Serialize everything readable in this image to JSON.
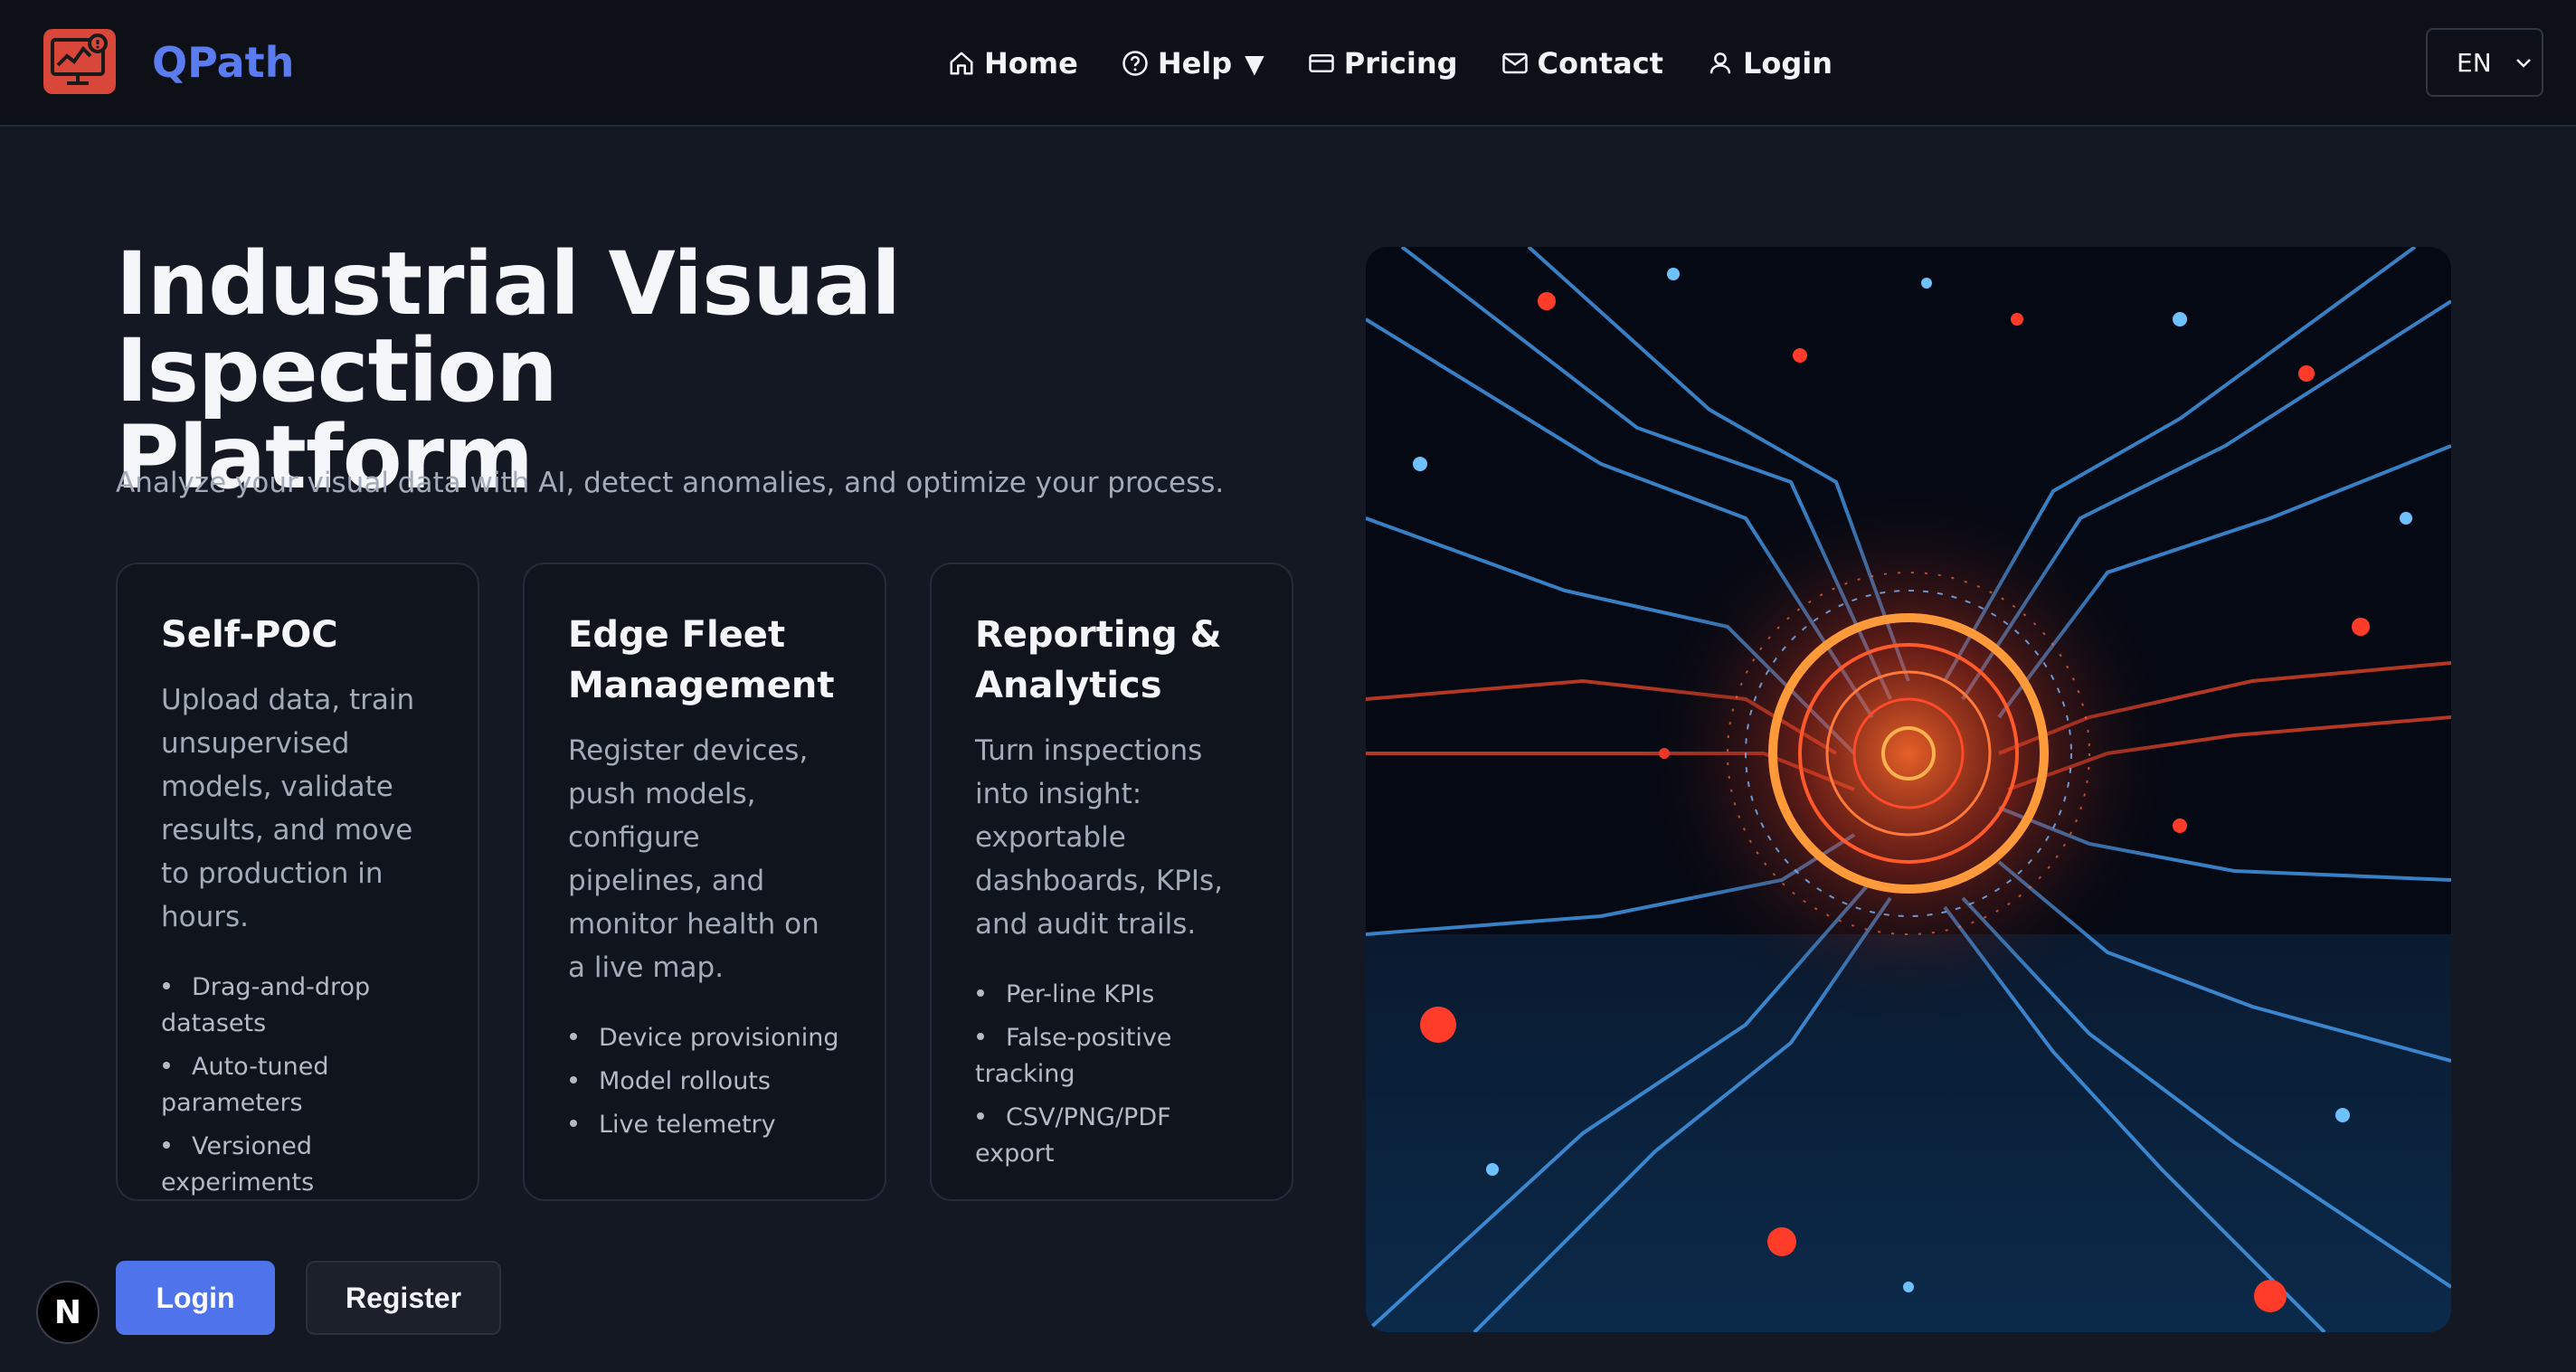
{
  "brand": {
    "name": "QPath",
    "logo_color": "#d9473a",
    "accent": "#5b7cf0"
  },
  "nav": {
    "items": [
      {
        "label": "Home",
        "icon": "home-icon"
      },
      {
        "label": "Help",
        "icon": "help-circle-icon",
        "caret": "▼"
      },
      {
        "label": "Pricing",
        "icon": "credit-card-icon"
      },
      {
        "label": "Contact",
        "icon": "mail-icon"
      },
      {
        "label": "Login",
        "icon": "user-icon"
      }
    ]
  },
  "language": {
    "selected": "EN"
  },
  "hero": {
    "title_line1": "Industrial Visual Ispection",
    "title_line2": "Platform",
    "subtitle": "Analyze your visual data with AI, detect anomalies, and optimize your process."
  },
  "cards": [
    {
      "title": "Self-POC",
      "description": "Upload data, train unsupervised models, validate results, and move to production in hours.",
      "bullets": [
        "Drag-and-drop datasets",
        "Auto-tuned parameters",
        "Versioned experiments"
      ]
    },
    {
      "title": "Edge Fleet Management",
      "description": "Register devices, push models, configure pipelines, and monitor health on a live map.",
      "bullets": [
        "Device provisioning",
        "Model rollouts",
        "Live telemetry"
      ]
    },
    {
      "title": "Reporting & Analytics",
      "description": "Turn inspections into insight: exportable dashboards, KPIs, and audit trails.",
      "bullets": [
        "Per-line KPIs",
        "False-positive tracking",
        "CSV/PNG/PDF export"
      ]
    }
  ],
  "actions": {
    "login_label": "Login",
    "register_label": "Register",
    "primary_color": "#4f73ea"
  },
  "badge": {
    "letter": "N"
  }
}
